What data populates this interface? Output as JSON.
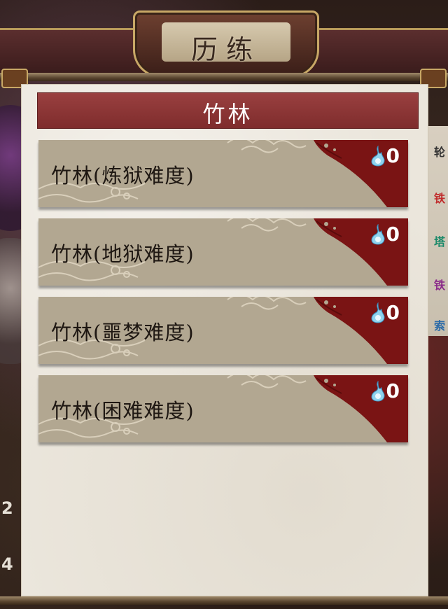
{
  "header": {
    "title": "历练"
  },
  "section": {
    "title": "竹林"
  },
  "levels": [
    {
      "label": "竹林(炼狱难度)",
      "cost": "0"
    },
    {
      "label": "竹林(地狱难度)",
      "cost": "0"
    },
    {
      "label": "竹林(噩梦难度)",
      "cost": "0"
    },
    {
      "label": "竹林(困难难度)",
      "cost": "0"
    }
  ],
  "background": {
    "side_numbers": [
      "2",
      "4"
    ],
    "right_text": [
      "轮",
      "铁",
      "塔",
      "铁",
      "索"
    ]
  },
  "icons": {
    "cost_icon": "blue-flame-icon"
  },
  "colors": {
    "banner": "#8a3434",
    "card": "#b2a791",
    "corner": "#7a1414",
    "flame": "#8fd3ee"
  }
}
